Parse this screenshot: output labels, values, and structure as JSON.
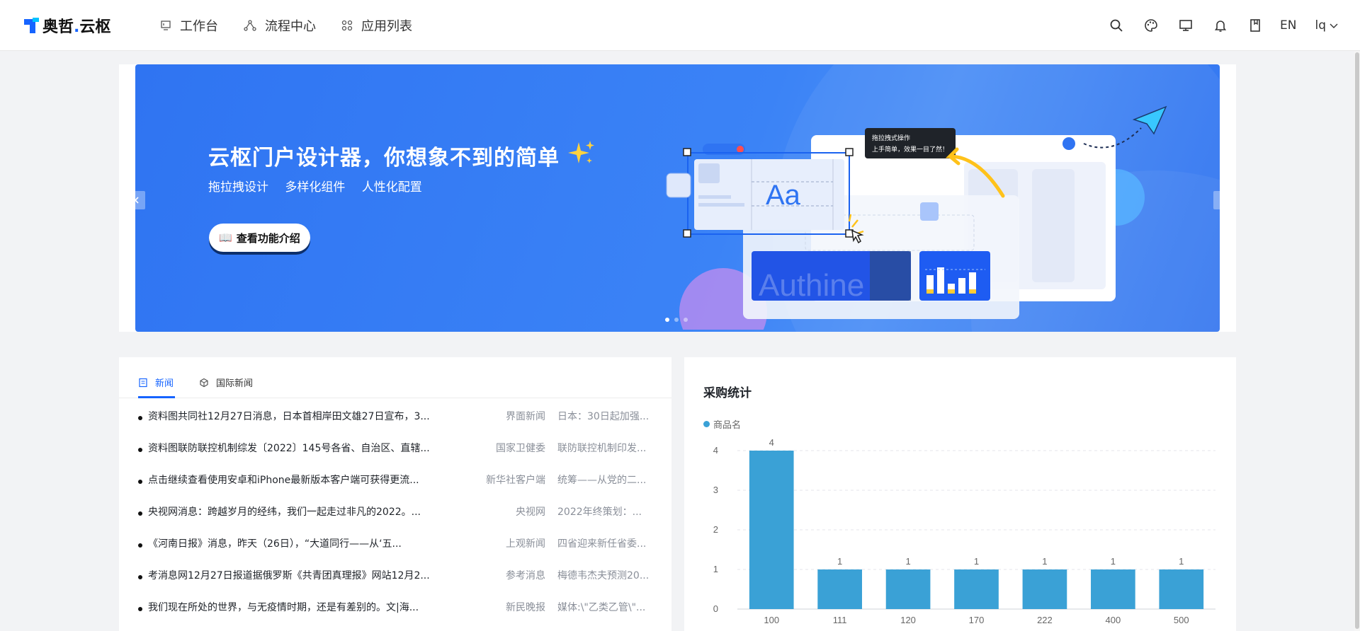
{
  "header": {
    "logo_text": "奥哲",
    "logo_dot": ".",
    "logo_text2": "云枢",
    "nav": [
      {
        "label": "工作台",
        "icon": "monitor-icon"
      },
      {
        "label": "流程中心",
        "icon": "flow-icon"
      },
      {
        "label": "应用列表",
        "icon": "grid-icon"
      }
    ],
    "tools": [
      "search-icon",
      "palette-icon",
      "desktop-icon",
      "bell-icon",
      "book-icon"
    ],
    "lang": "EN",
    "user": "lq"
  },
  "banner": {
    "title": "云枢门户设计器，你想象不到的简单",
    "subs": [
      "拖拉拽设计",
      "多样化组件",
      "人性化配置"
    ],
    "button_label": "查看功能介绍",
    "button_icon": "📖",
    "tooltip_line1": "拖拉拽式操作",
    "tooltip_line2": "上手简单，效果一目了然！",
    "watermark": "Authine",
    "slides": 3,
    "active_slide": 1
  },
  "news": {
    "tabs": [
      "新闻",
      "国际新闻"
    ],
    "rows": [
      {
        "title": "资料图共同社12月27日消息，日本首相岸田文雄27日宣布，3...",
        "source": "界面新闻",
        "summary": "日本：30日起加强..."
      },
      {
        "title": "资料图联防联控机制综发〔2022〕145号各省、自治区、直辖...",
        "source": "国家卫健委",
        "summary": "联防联控机制印发..."
      },
      {
        "title": "点击继续查看使用安卓和iPhone最新版本客户端可获得更流...",
        "source": "新华社客户端",
        "summary": "统筹——从党的二..."
      },
      {
        "title": "央视网消息：跨越岁月的经纬，我们一起走过非凡的2022。...",
        "source": "央视网",
        "summary": "2022年终策划：..."
      },
      {
        "title": "《河南日报》消息，昨天（26日），“大道同行——从‘五...",
        "source": "上观新闻",
        "summary": "四省迎来新任省委..."
      },
      {
        "title": "考消息网12月27日报道据俄罗斯《共青团真理报》网站12月2...",
        "source": "参考消息",
        "summary": "梅德韦杰夫预测20..."
      },
      {
        "title": "我们现在所处的世界，与无疫情时期，还是有差别的。文|海...",
        "source": "新民晚报",
        "summary": "媒体:\\\"乙类乙管\\\"..."
      }
    ]
  },
  "purchase": {
    "title": "采购统计",
    "color": "#3aa1d6"
  },
  "chart_data": {
    "type": "bar",
    "title": "采购统计",
    "categories": [
      "100",
      "111",
      "120",
      "170",
      "222",
      "400",
      "500"
    ],
    "series": [
      {
        "name": "商品名",
        "values": [
          4,
          1,
          1,
          1,
          1,
          1,
          1
        ]
      }
    ],
    "ylim": [
      0,
      4
    ],
    "yticks": [
      "0",
      "1",
      "2",
      "3",
      "4"
    ],
    "grid": true,
    "legend": "top-left"
  }
}
